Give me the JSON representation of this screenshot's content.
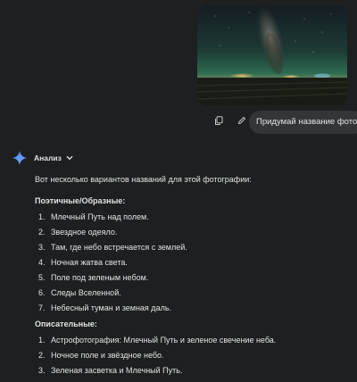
{
  "user_message": {
    "text": "Придумай название фото",
    "copy_icon": "copy-icon",
    "edit_icon": "edit-pencil-icon"
  },
  "model": {
    "logo_icon": "gemini-spark-icon",
    "analysis_label": "Анализ",
    "intro": "Вот несколько вариантов названий для этой фотографии:",
    "sections": [
      {
        "title": "Поэтичные/Образные:",
        "items": [
          "Млечный Путь над полем.",
          "Звездное одеяло.",
          "Там, где небо встречается с землей.",
          "Ночная жатва света.",
          "Поле под зеленым небом.",
          "Следы Вселенной.",
          "Небесный туман и земная даль."
        ]
      },
      {
        "title": "Описательные:",
        "items": [
          "Астрофотография: Млечный Путь и зеленое свечение неба.",
          "Ночное поле и звёздное небо.",
          "Зеленая засветка и Млечный Путь."
        ]
      }
    ]
  },
  "colors": {
    "background": "#1e1f20",
    "bubble": "#333537",
    "text": "#e3e3e3",
    "accent_blue": "#4f8cf7"
  }
}
